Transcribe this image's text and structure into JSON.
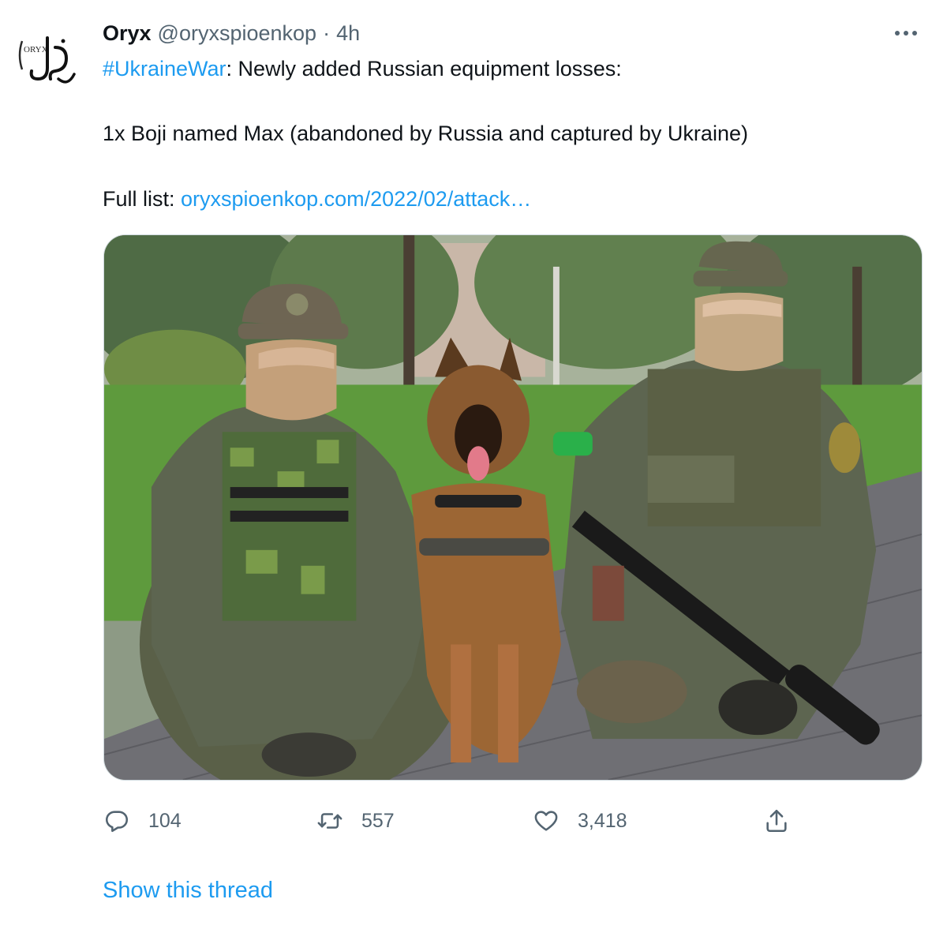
{
  "author": {
    "display_name": "Oryx",
    "handle": "@oryxspioenkop",
    "separator": "·",
    "time": "4h",
    "avatar_text": "ORYX"
  },
  "tweet": {
    "hashtag": "#UkraineWar",
    "line1_rest": ": Newly added Russian equipment losses:",
    "line2": "1x Boji named Max (abandoned by Russia and captured by Ukraine)",
    "line3_prefix": "Full list: ",
    "link": "oryxspioenkop.com/2022/02/attack…"
  },
  "actions": {
    "replies": "104",
    "retweets": "557",
    "likes": "3,418"
  },
  "show_thread": "Show this thread",
  "colors": {
    "accent": "#1d9bf0",
    "secondary_text": "#536471",
    "primary_text": "#0f1419"
  },
  "icons": {
    "more": "more-horizontal-icon",
    "reply": "reply-icon",
    "retweet": "retweet-icon",
    "like": "heart-icon",
    "share": "share-icon"
  }
}
